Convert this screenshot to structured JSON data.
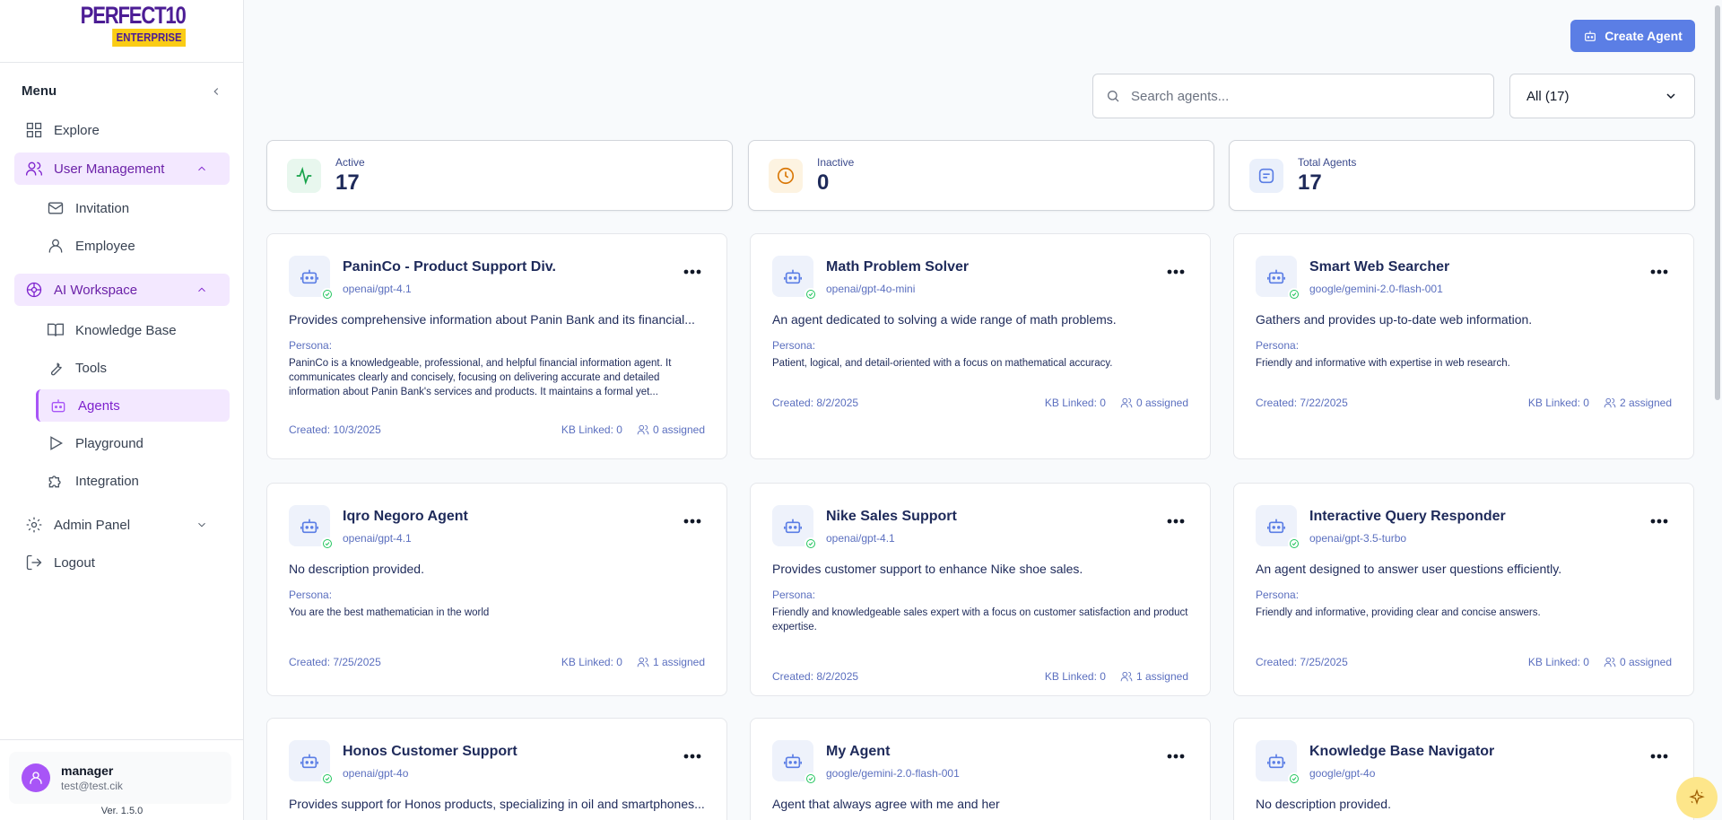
{
  "brand": {
    "main": "PERFECT10",
    "sub": "ENTERPRISE"
  },
  "menu": {
    "title": "Menu"
  },
  "nav": {
    "explore": "Explore",
    "user_management": "User Management",
    "invitation": "Invitation",
    "employee": "Employee",
    "ai_workspace": "AI Workspace",
    "knowledge_base": "Knowledge Base",
    "tools": "Tools",
    "agents": "Agents",
    "playground": "Playground",
    "integration": "Integration",
    "admin_panel": "Admin Panel",
    "logout": "Logout"
  },
  "user": {
    "name": "manager",
    "email": "test@test.cik",
    "version": "Ver. 1.5.0"
  },
  "toolbar": {
    "create_label": "Create Agent",
    "search_placeholder": "Search agents...",
    "filter_value": "All (17)"
  },
  "stats": [
    {
      "label": "Active",
      "value": "17",
      "icon": "activity-icon",
      "color": "#16a34a",
      "bg": "#e8f7ee"
    },
    {
      "label": "Inactive",
      "value": "0",
      "icon": "clock-icon",
      "color": "#d97706",
      "bg": "#fdf3e1"
    },
    {
      "label": "Total Agents",
      "value": "17",
      "icon": "message-square-icon",
      "color": "#5b7ee5",
      "bg": "#eaf0fb"
    }
  ],
  "persona_label": "Persona:",
  "agents": [
    {
      "name": "PaninCo - Product Support Div.",
      "model": "openai/gpt-4.1",
      "description": "Provides comprehensive information about Panin Bank and its financial...",
      "persona": "PaninCo is a knowledgeable, professional, and helpful financial information agent. It communicates clearly and concisely, focusing on delivering accurate and detailed information about Panin Bank's services and products. It maintains a formal yet...",
      "created": "Created: 10/3/2025",
      "kb": "KB Linked: 0",
      "assigned": "0 assigned"
    },
    {
      "name": "Math Problem Solver",
      "model": "openai/gpt-4o-mini",
      "description": "An agent dedicated to solving a wide range of math problems.",
      "persona": "Patient, logical, and detail-oriented with a focus on mathematical accuracy.",
      "created": "Created: 8/2/2025",
      "kb": "KB Linked: 0",
      "assigned": "0 assigned"
    },
    {
      "name": "Smart Web Searcher",
      "model": "google/gemini-2.0-flash-001",
      "description": "Gathers and provides up-to-date web information.",
      "persona": "Friendly and informative with expertise in web research.",
      "created": "Created: 7/22/2025",
      "kb": "KB Linked: 0",
      "assigned": "2 assigned"
    },
    {
      "name": "Iqro Negoro Agent",
      "model": "openai/gpt-4.1",
      "description": "No description provided.",
      "persona": "You are the best mathematician in the world",
      "created": "Created: 7/25/2025",
      "kb": "KB Linked: 0",
      "assigned": "1 assigned"
    },
    {
      "name": "Nike Sales Support",
      "model": "openai/gpt-4.1",
      "description": "Provides customer support to enhance Nike shoe sales.",
      "persona": "Friendly and knowledgeable sales expert with a focus on customer satisfaction and product expertise.",
      "created": "Created: 8/2/2025",
      "kb": "KB Linked: 0",
      "assigned": "1 assigned"
    },
    {
      "name": "Interactive Query Responder",
      "model": "openai/gpt-3.5-turbo",
      "description": "An agent designed to answer user questions efficiently.",
      "persona": "Friendly and informative, providing clear and concise answers.",
      "created": "Created: 7/25/2025",
      "kb": "KB Linked: 0",
      "assigned": "0 assigned"
    },
    {
      "name": "Honos Customer Support",
      "model": "openai/gpt-4o",
      "description": "Provides support for Honos products, specializing in oil and smartphones..."
    },
    {
      "name": "My Agent",
      "model": "google/gemini-2.0-flash-001",
      "description": "Agent that always agree with me and her"
    },
    {
      "name": "Knowledge Base Navigator",
      "model": "google/gpt-4o",
      "description": "No description provided."
    }
  ]
}
